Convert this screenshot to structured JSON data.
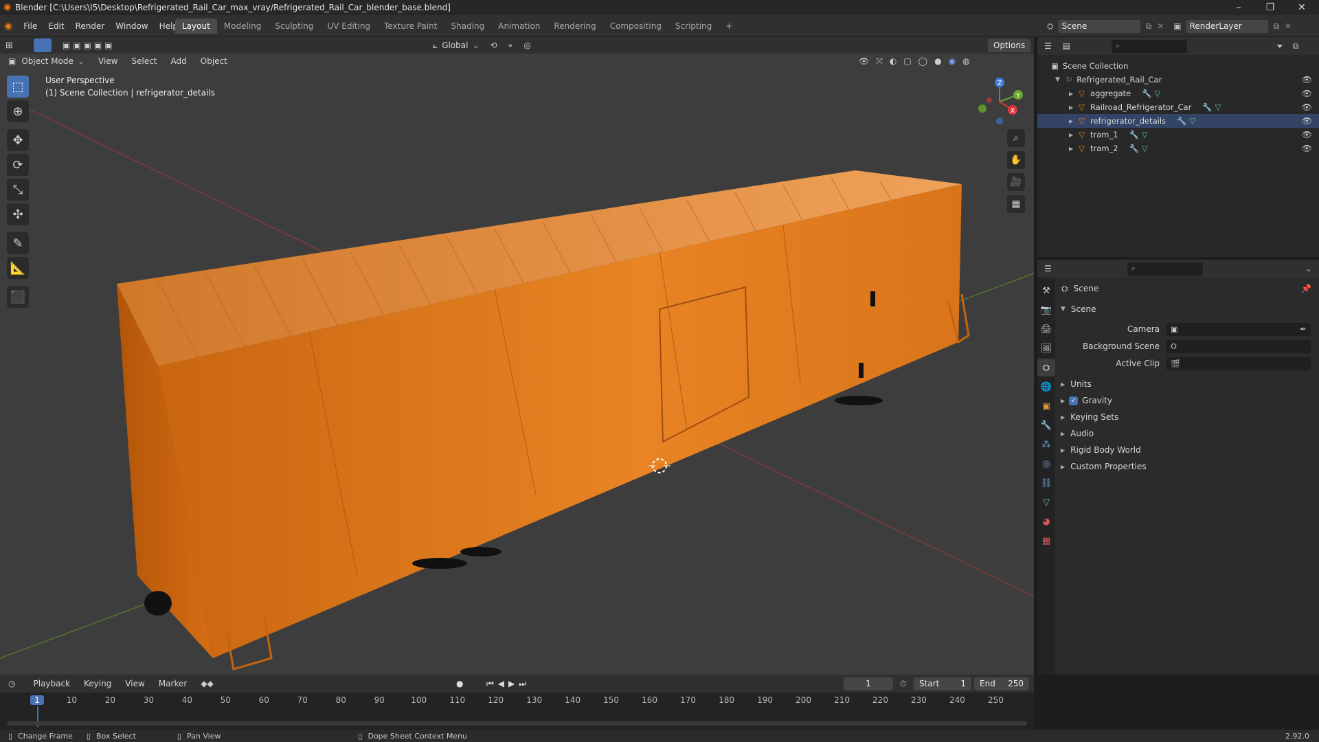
{
  "window": {
    "title": "Blender [C:\\Users\\I5\\Desktop\\Refrigerated_Rail_Car_max_vray/Refrigerated_Rail_Car_blender_base.blend]"
  },
  "menubar": {
    "items": [
      "File",
      "Edit",
      "Render",
      "Window",
      "Help"
    ]
  },
  "workspaces": {
    "tabs": [
      "Layout",
      "Modeling",
      "Sculpting",
      "UV Editing",
      "Texture Paint",
      "Shading",
      "Animation",
      "Rendering",
      "Compositing",
      "Scripting"
    ],
    "active": "Layout",
    "add_label": "+"
  },
  "scene_selector": {
    "scene": "Scene",
    "render_layer": "RenderLayer"
  },
  "viewport_header": {
    "transform_orientation": "Global",
    "options": "Options",
    "mode": "Object Mode",
    "menus": [
      "View",
      "Select",
      "Add",
      "Object"
    ]
  },
  "viewport": {
    "perspective_label": "User Perspective",
    "collection_label": "(1) Scene Collection | refrigerator_details",
    "gizmo_axes": [
      "Z",
      "Y",
      "X"
    ]
  },
  "outliner": {
    "root": "Scene Collection",
    "collection": "Refrigerated_Rail_Car",
    "objects": [
      "aggregate",
      "Railroad_Refrigerator_Car",
      "refrigerator_details",
      "tram_1",
      "tram_2"
    ]
  },
  "properties": {
    "breadcrumb": "Scene",
    "panel_title": "Scene",
    "fields": [
      {
        "label": "Camera",
        "value": ""
      },
      {
        "label": "Background Scene",
        "value": ""
      },
      {
        "label": "Active Clip",
        "value": ""
      }
    ],
    "sections": [
      "Units",
      "Gravity",
      "Keying Sets",
      "Audio",
      "Rigid Body World",
      "Custom Properties"
    ],
    "gravity_checked": true
  },
  "timeline": {
    "menus": [
      "Playback",
      "Keying",
      "View",
      "Marker"
    ],
    "current_frame": "1",
    "start_label": "Start",
    "start": "1",
    "end_label": "End",
    "end": "250",
    "ticks": [
      "1",
      "10",
      "20",
      "30",
      "40",
      "50",
      "60",
      "70",
      "80",
      "90",
      "100",
      "110",
      "120",
      "130",
      "140",
      "150",
      "160",
      "170",
      "180",
      "190",
      "200",
      "210",
      "220",
      "230",
      "240",
      "250"
    ]
  },
  "statusbar": {
    "items": [
      "Change Frame",
      "Box Select",
      "Pan View",
      "Dope Sheet Context Menu"
    ],
    "version": "2.92.0"
  },
  "colors": {
    "accent": "#4772b3",
    "railcar": "#e07a1f",
    "viewport_bg": "#3d3d3d"
  }
}
